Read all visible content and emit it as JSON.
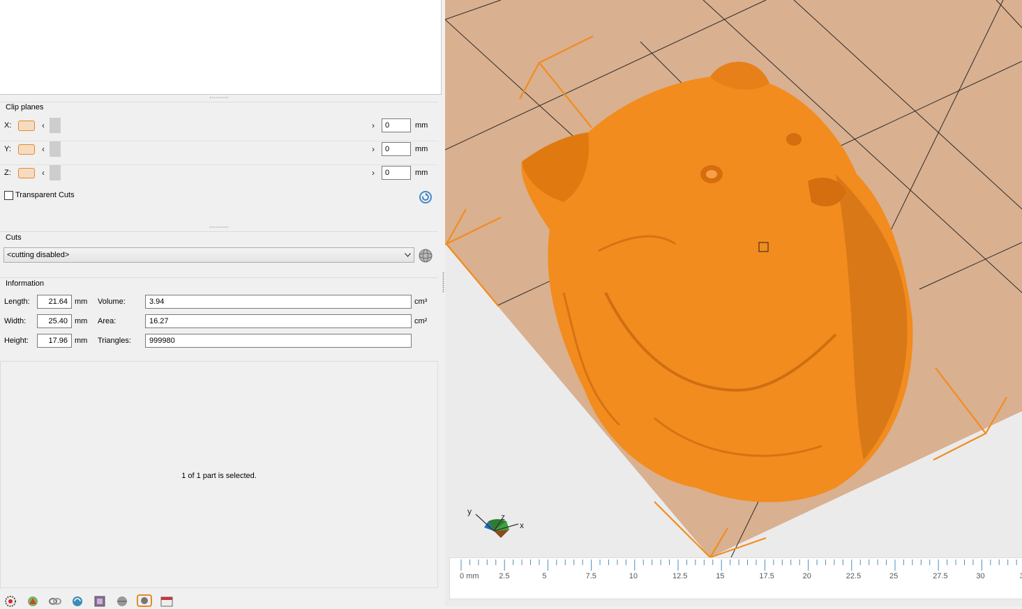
{
  "clip_planes": {
    "title": "Clip planes",
    "unit": "mm",
    "axes": [
      {
        "label": "X:",
        "value": "0"
      },
      {
        "label": "Y:",
        "value": "0"
      },
      {
        "label": "Z:",
        "value": "0"
      }
    ],
    "transparent_cuts_label": "Transparent Cuts",
    "transparent_cuts_checked": false
  },
  "cuts": {
    "title": "Cuts",
    "selected": "<cutting disabled>"
  },
  "information": {
    "title": "Information",
    "length_label": "Length:",
    "length_value": "21.64",
    "length_unit": "mm",
    "width_label": "Width:",
    "width_value": "25.40",
    "width_unit": "mm",
    "height_label": "Height:",
    "height_value": "17.96",
    "height_unit": "mm",
    "volume_label": "Volume:",
    "volume_value": "3.94",
    "volume_unit": "cm³",
    "area_label": "Area:",
    "area_value": "16.27",
    "area_unit": "cm²",
    "triangles_label": "Triangles:",
    "triangles_value": "999980"
  },
  "status": {
    "selection_text": "1 of 1 part is selected."
  },
  "toolbar": {
    "icons": [
      "settings-gear-icon",
      "color-tool-icon",
      "link-icon",
      "refresh-icon",
      "box-icon",
      "sphere-icon",
      "active-view-icon",
      "calendar-icon"
    ]
  },
  "viewport": {
    "axis_labels": {
      "x": "x",
      "y": "y",
      "z": "z"
    },
    "ruler_labels": [
      "0 mm",
      "2.5",
      "5",
      "7.5",
      "10",
      "12.5",
      "15",
      "17.5",
      "20",
      "22.5",
      "25",
      "27.5",
      "30",
      "3"
    ],
    "model_color": "#f28c1e",
    "bed_color": "#d9b090"
  }
}
